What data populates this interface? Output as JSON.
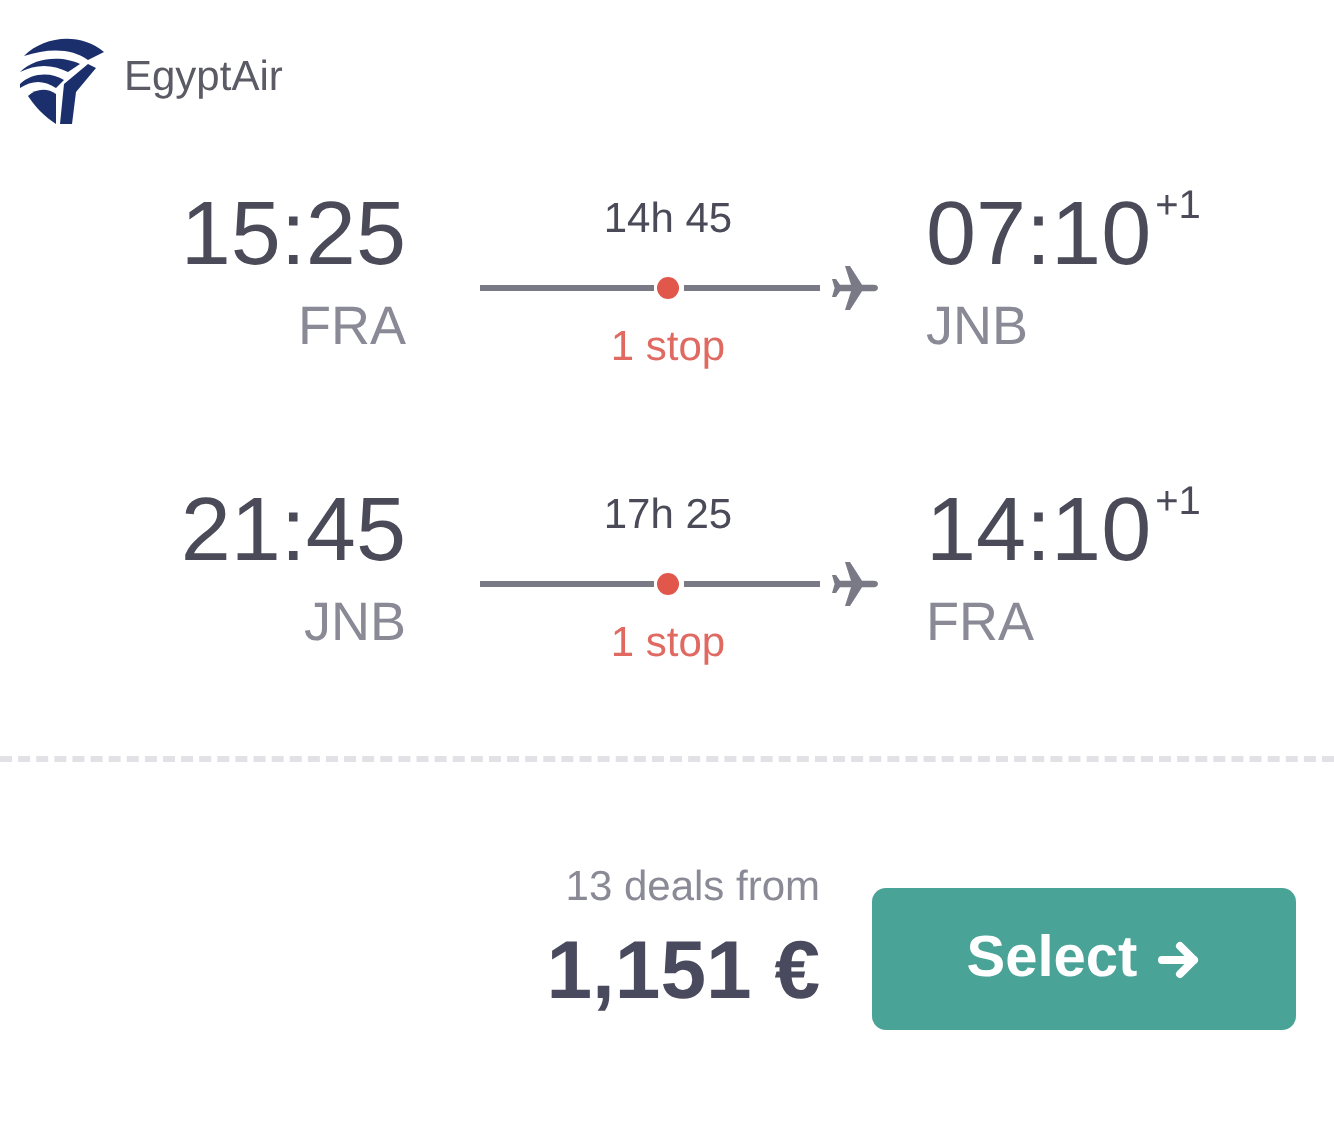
{
  "airline": {
    "name": "EgyptAir"
  },
  "legs": [
    {
      "departure_time": "15:25",
      "departure_airport": "FRA",
      "duration": "14h 45",
      "stops": "1 stop",
      "arrival_time": "07:10",
      "day_offset": "+1",
      "arrival_airport": "JNB"
    },
    {
      "departure_time": "21:45",
      "departure_airport": "JNB",
      "duration": "17h 25",
      "stops": "1 stop",
      "arrival_time": "14:10",
      "day_offset": "+1",
      "arrival_airport": "FRA"
    }
  ],
  "price": {
    "deals": "13 deals from",
    "amount": "1,151 €"
  },
  "select_button": {
    "label": "Select"
  }
}
